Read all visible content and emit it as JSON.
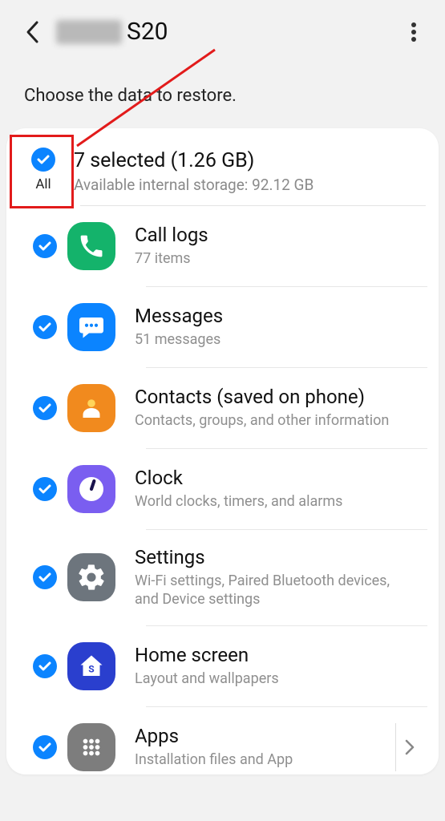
{
  "header": {
    "title_suffix": "S20"
  },
  "subtitle": "Choose the data to restore.",
  "all": {
    "label": "All",
    "selected_text": "7 selected (1.26 GB)",
    "storage_text": "Available internal storage: 92.12 GB"
  },
  "items": [
    {
      "title": "Call logs",
      "sub": "77 items"
    },
    {
      "title": "Messages",
      "sub": "51 messages"
    },
    {
      "title": "Contacts (saved on phone)",
      "sub": "Contacts, groups, and other information"
    },
    {
      "title": "Clock",
      "sub": "World clocks, timers, and alarms"
    },
    {
      "title": "Settings",
      "sub": "Wi-Fi settings, Paired Bluetooth devices, and Device settings"
    },
    {
      "title": "Home screen",
      "sub": "Layout and wallpapers"
    },
    {
      "title": "Apps",
      "sub": "Installation files and App"
    }
  ]
}
